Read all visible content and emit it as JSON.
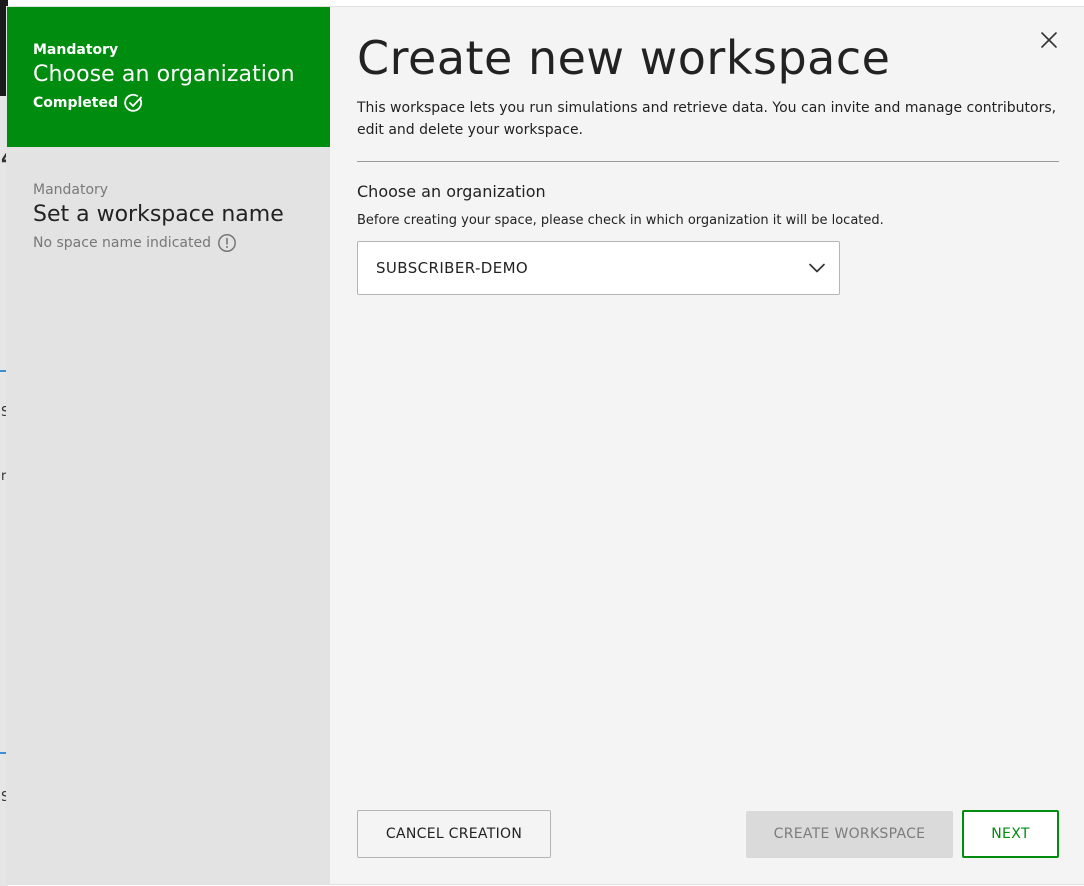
{
  "background": {
    "fragments": [
      "4",
      "S",
      "r",
      "S"
    ]
  },
  "stepper": {
    "steps": [
      {
        "kicker": "Mandatory",
        "title": "Choose an organization",
        "status": "Completed",
        "status_icon": "check-circle-icon",
        "state": "completed"
      },
      {
        "kicker": "Mandatory",
        "title": "Set a workspace name",
        "status": "No space name indicated",
        "status_icon": "exclamation-circle-icon",
        "state": "pending"
      }
    ]
  },
  "main": {
    "title": "Create new workspace",
    "description": "This workspace lets you run simulations and retrieve data. You can invite and manage contributors, edit and delete your workspace.",
    "section": {
      "title": "Choose an organization",
      "description": "Before creating your space, please check in which organization it will be located.",
      "select_value": "SUBSCRIBER-DEMO"
    }
  },
  "footer": {
    "cancel_label": "CANCEL CREATION",
    "create_label": "CREATE WORKSPACE",
    "next_label": "NEXT"
  },
  "colors": {
    "accent": "#008c0e",
    "sidebar": "#e3e3e3",
    "panel": "#f4f4f4",
    "disabled": "#dadada"
  }
}
